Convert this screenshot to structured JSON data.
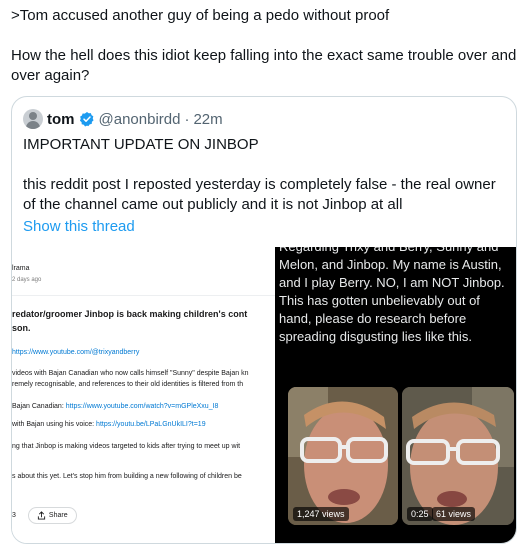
{
  "post": {
    "line1": ">Tom accused another guy of being a pedo without proof",
    "line2": "How the hell does this idiot keep falling into the exact same trouble over and over again?"
  },
  "quote": {
    "name": "tom",
    "handle": "@anonbirdd",
    "dot": "·",
    "time": "22m",
    "body1": "IMPORTANT UPDATE ON JINBOP",
    "body2": "this reddit post I reposted yesterday is completely false - the real owner of the channel came out publicly and it is not Jinbop at all",
    "show_thread": "Show this thread"
  },
  "reddit_shot": {
    "sub": "lrama",
    "age": "2 days ago",
    "title1": "redator/groomer Jinbop is back making children's cont",
    "title2": "son.",
    "link1": "https://www.youtube.com/@trixyandberry",
    "line1": "videos with Bajan Canadian who now calls himself \"Sunny\" despite Bajan kn",
    "line2": "remely recognisable, and references to their old identities is filtered from th",
    "line3_label": "Bajan Canadian: ",
    "line3_link": "https://www.youtube.com/watch?v=mGPleXxu_I8",
    "line4_label": "with Bajan using his voice: ",
    "line4_link": "https://youtu.be/LPaLGnUkILI?t=19",
    "line5": "ng that Jinbop is making videos targeted to kids after trying to meet up wit",
    "line6": "s about this yet. Let's stop him from building a new following of children be",
    "count": "3",
    "share_label": "Share"
  },
  "video_shot": {
    "statement": "Regarding Trixy and Berry, Sunny and Melon, and Jinbop. My name is Austin, and I play Berry. NO, I am NOT Jinbop. This has gotten unbelievably out of hand, please do research before spreading disgusting lies like this.",
    "thumb1_views": "1,247 views",
    "thumb2_duration": "0:25",
    "thumb2_views": "61 views"
  },
  "colors": {
    "link_blue": "#1d9bf0",
    "secondary_text": "#536471",
    "verified_blue": "#1d9bf0",
    "border": "#cfd9de"
  }
}
